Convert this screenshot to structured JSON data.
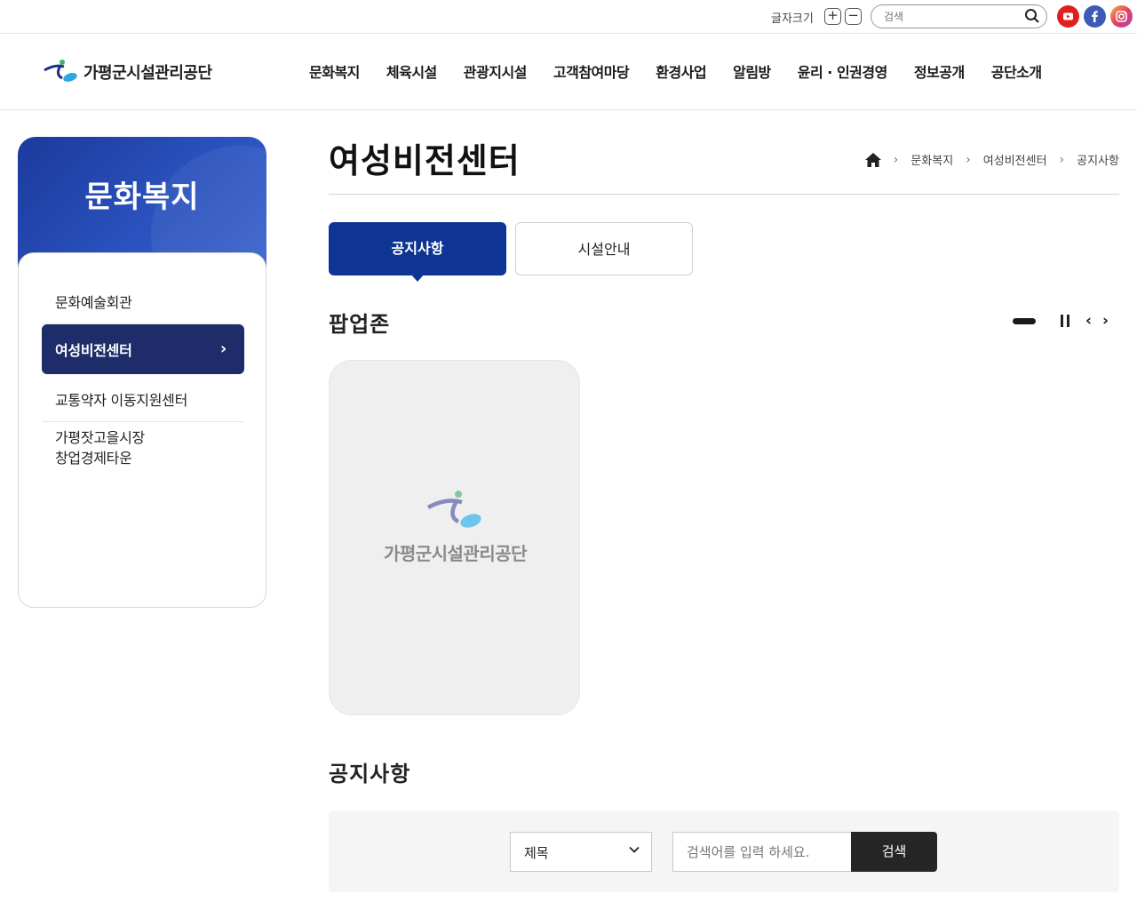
{
  "topbar": {
    "font_size_label": "글자크기",
    "font_plus": "+",
    "font_minus": "−",
    "search_placeholder": "검색",
    "social": [
      "youtube-icon",
      "facebook-icon",
      "instagram-icon"
    ]
  },
  "header": {
    "logo_text": "가평군시설관리공단",
    "nav": [
      "문화복지",
      "체육시설",
      "관광지시설",
      "고객참여마당",
      "환경사업",
      "알림방",
      "윤리 · 인권경영",
      "정보공개",
      "공단소개"
    ]
  },
  "sidebar": {
    "title": "문화복지",
    "items": [
      {
        "label": "문화예술회관",
        "active": false
      },
      {
        "label": "여성비전센터",
        "active": true
      },
      {
        "label": "교통약자 이동지원센터",
        "active": false
      },
      {
        "label": "가평잣고을시장\n창업경제타운",
        "line1": "가평잣고을시장",
        "line2": "창업경제타운",
        "active": false
      }
    ]
  },
  "content": {
    "page_title": "여성비전센터",
    "breadcrumb": [
      "문화복지",
      "여성비전센터",
      "공지사항"
    ],
    "tabs": [
      {
        "label": "공지사항",
        "active": true
      },
      {
        "label": "시설안내",
        "active": false
      }
    ],
    "popup_zone_title": "팝업존",
    "popup_logo_text": "가평군시설관리공단",
    "notice_title": "공지사항",
    "search": {
      "select_value": "제목",
      "keyword_placeholder": "검색어를 입력 하세요.",
      "button_label": "검색"
    }
  },
  "colors": {
    "primary": "#0e3494",
    "sidebar_active": "#1e2c6a",
    "search_button": "#262626"
  }
}
